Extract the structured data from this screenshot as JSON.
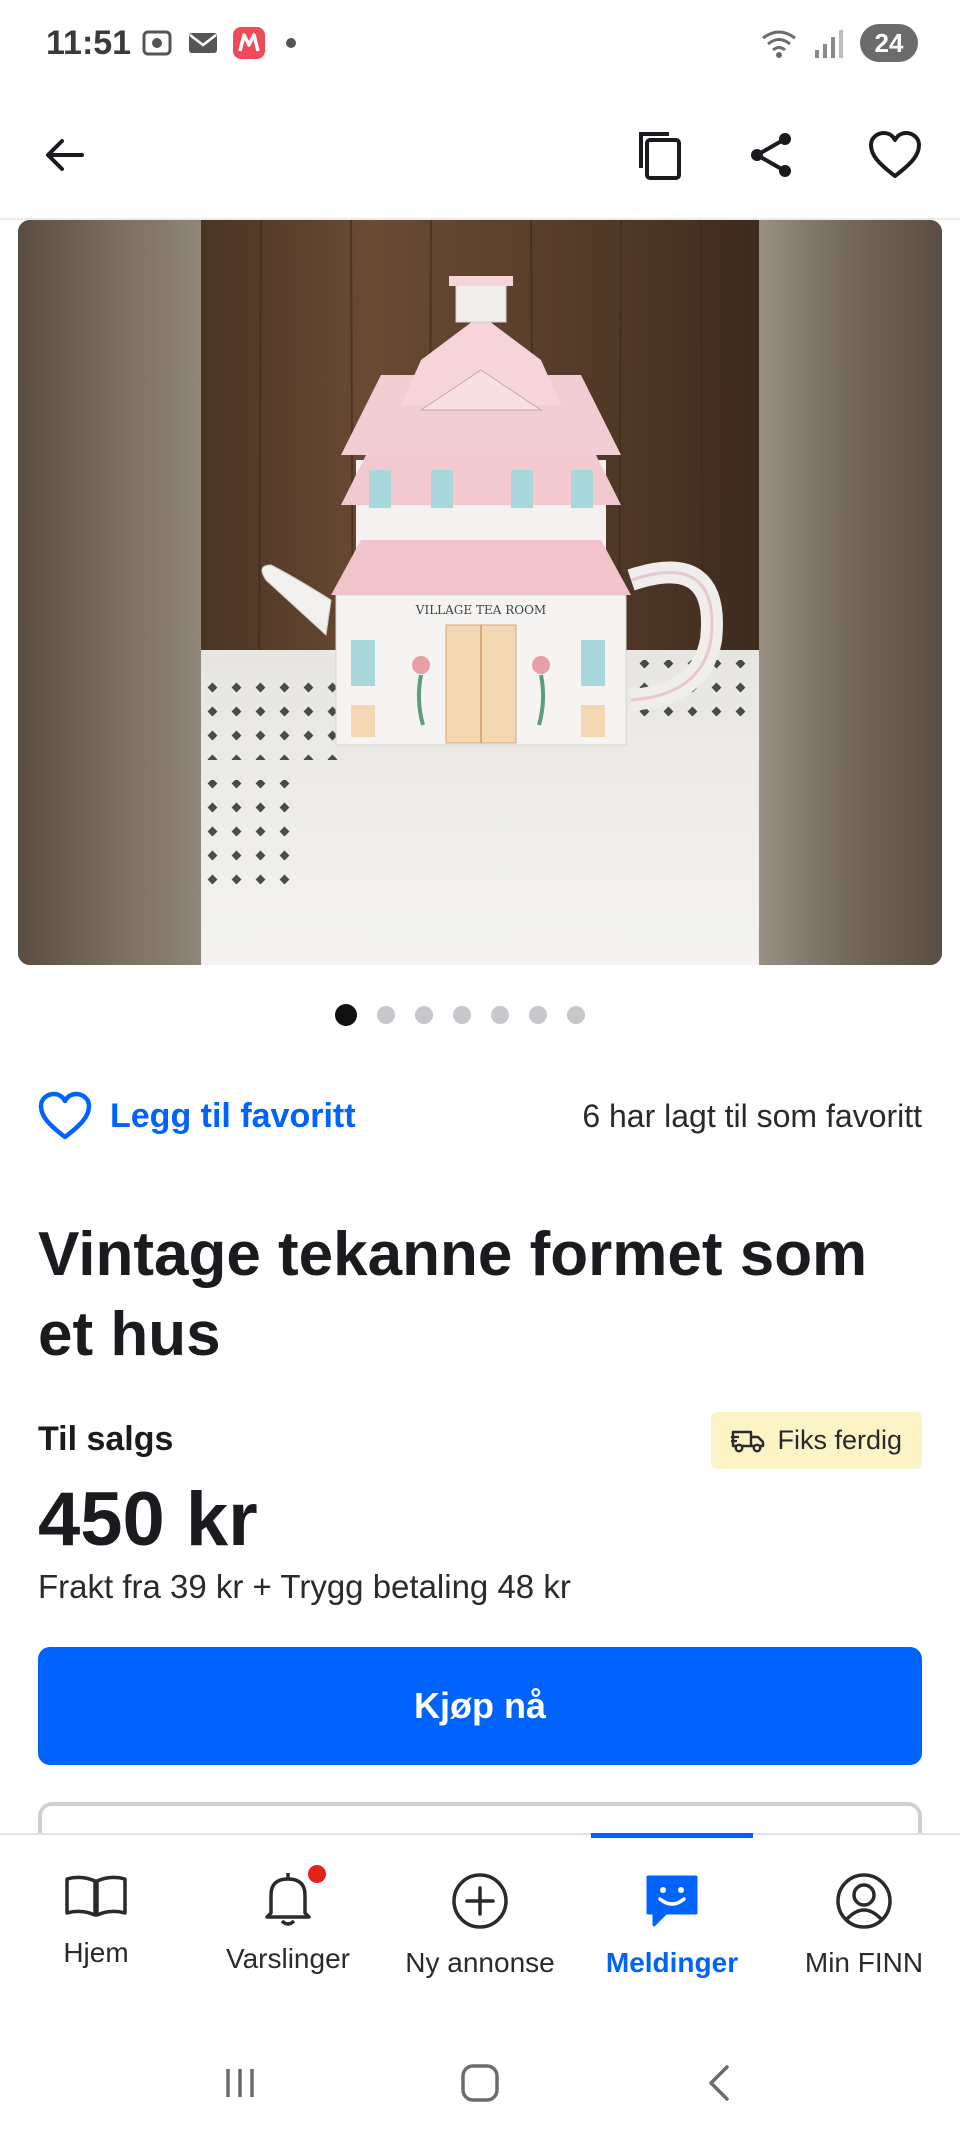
{
  "status_bar": {
    "time": "11:51",
    "battery": "24"
  },
  "toolbar": {
    "back_icon": "arrow-left-icon",
    "copy_icon": "copy-icon",
    "share_icon": "share-icon",
    "favorite_icon": "heart-outline-icon"
  },
  "gallery": {
    "image_count": 7,
    "current_index": 1,
    "plaque_text": "VILLAGE TEA ROOM"
  },
  "favorite": {
    "label": "Legg til favoritt",
    "count_text": "6 har lagt til som favoritt"
  },
  "listing": {
    "title": "Vintage tekanne formet som et hus",
    "sale_type": "Til salgs",
    "badge": "Fiks ferdig",
    "price": "450 kr",
    "shipping": "Frakt fra 39 kr + Trygg betaling 48 kr",
    "buy_label": "Kjøp nå"
  },
  "bottom_nav": {
    "items": [
      {
        "label": "Hjem",
        "icon": "book-icon"
      },
      {
        "label": "Varslinger",
        "icon": "bell-icon"
      },
      {
        "label": "Ny annonse",
        "icon": "plus-circle-icon"
      },
      {
        "label": "Meldinger",
        "icon": "chat-icon",
        "active": true
      },
      {
        "label": "Min FINN",
        "icon": "profile-icon"
      }
    ]
  },
  "colors": {
    "accent": "#0063fb",
    "badge_bg": "#fcf3c6",
    "notification": "#e3221c"
  }
}
